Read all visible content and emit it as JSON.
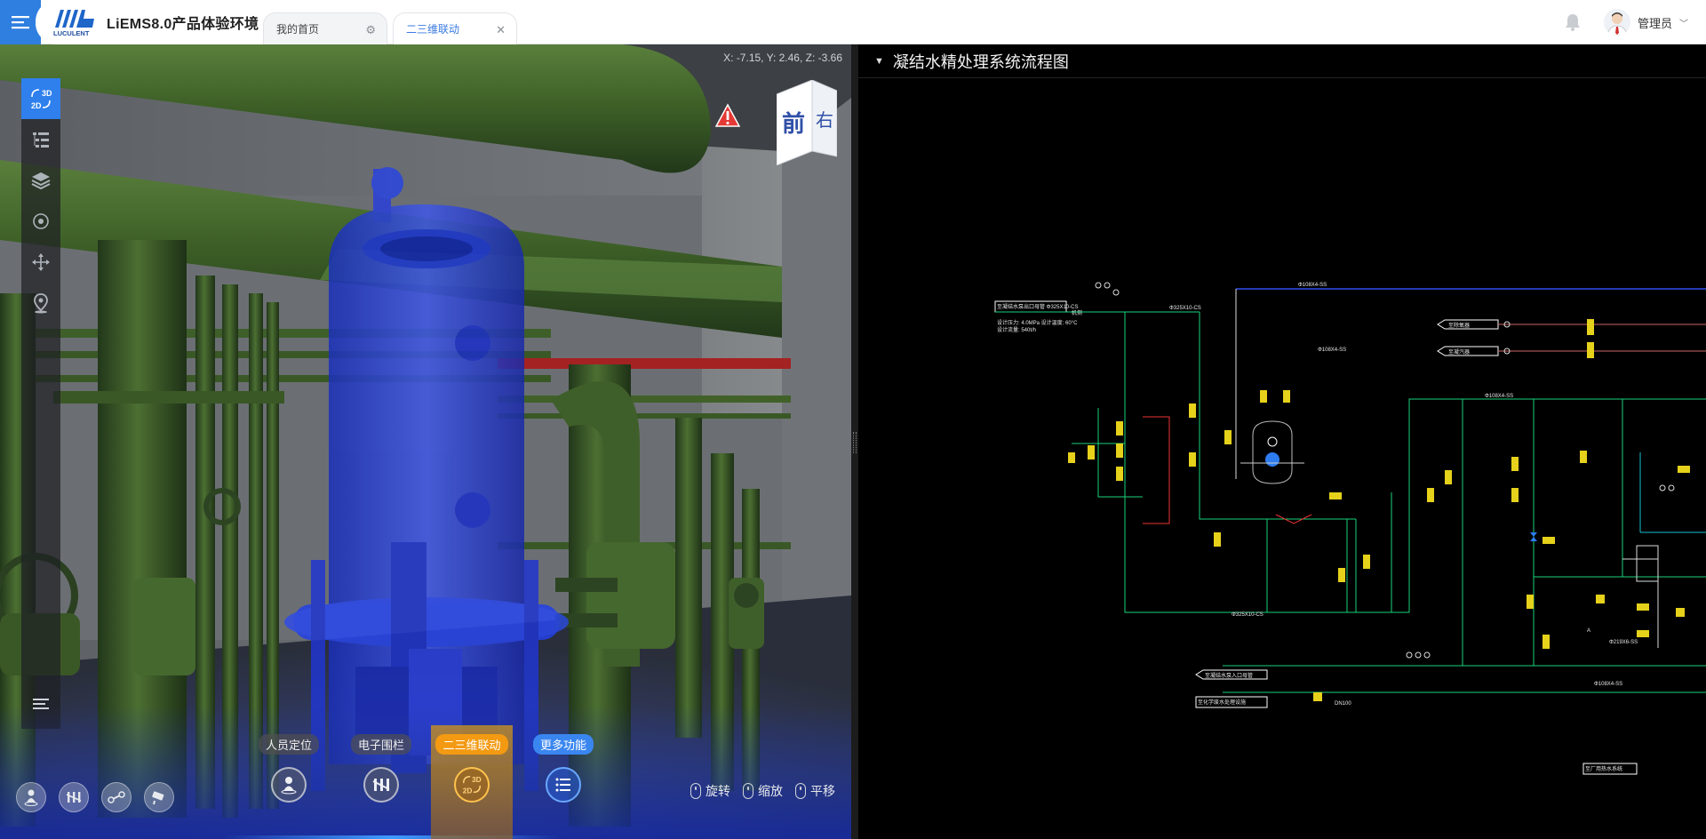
{
  "header": {
    "app_title": "LiEMS8.0产品体验环境",
    "logo_text": "LUCULENT",
    "tabs": [
      {
        "label": "我的首页",
        "icon": "gear-icon"
      },
      {
        "label": "二三维联动",
        "icon": "close-icon",
        "active": true
      }
    ],
    "user_name": "管理员",
    "accent": "#2f7fe0"
  },
  "viewport": {
    "coords": "X: -7.15, Y: 2.46, Z: -3.66",
    "view_cube": {
      "front": "前",
      "right": "右"
    },
    "left_tools": [
      {
        "icon": "toggle-2d-3d-icon",
        "label": "3D 2D",
        "active": true
      },
      {
        "icon": "tree-list-icon"
      },
      {
        "icon": "layers-icon"
      },
      {
        "icon": "target-icon"
      },
      {
        "icon": "move-icon"
      },
      {
        "icon": "location-pin-icon"
      }
    ],
    "bottom_left_tools": [
      "person-location-icon",
      "fence-icon",
      "drone-icon",
      "camera-icon"
    ],
    "functions": [
      {
        "label": "人员定位",
        "icon": "person-location-icon"
      },
      {
        "label": "电子围栏",
        "icon": "fence-icon"
      },
      {
        "label": "二三维联动",
        "icon": "toggle-2d-3d-icon",
        "active": true
      },
      {
        "label": "更多功能",
        "icon": "list-icon"
      }
    ],
    "mouse_hints": [
      "旋转",
      "缩放",
      "平移"
    ],
    "highlight_color": "#1a3cff",
    "pipe_color": "#3f5f2a"
  },
  "panel": {
    "title": "凝结水精处理系统流程图",
    "diagram_labels": {
      "top_line": "Φ108X4-SS",
      "inlet": "至凝结水泵出口母管 Φ325X10-CS",
      "inlet_note1": "设计压力: 4.0MPa 设计温度: 60°C",
      "inlet_note2": "设计流量: 540t/h",
      "machine_side": "机侧",
      "pipe_a": "Φ325X10-CS",
      "pipe_b": "Φ108X4-SS",
      "pipe_c": "Φ219X6-SS",
      "tank_top": "Φ108X4-SS",
      "outlet1": "至除氧器",
      "outlet2": "至凝汽器",
      "return1": "至凝结水泵入口母管",
      "return2": "至化学废水处理设施",
      "dn": "DN100",
      "label_a": "A",
      "bottom_right": "至厂用热水系统"
    }
  }
}
